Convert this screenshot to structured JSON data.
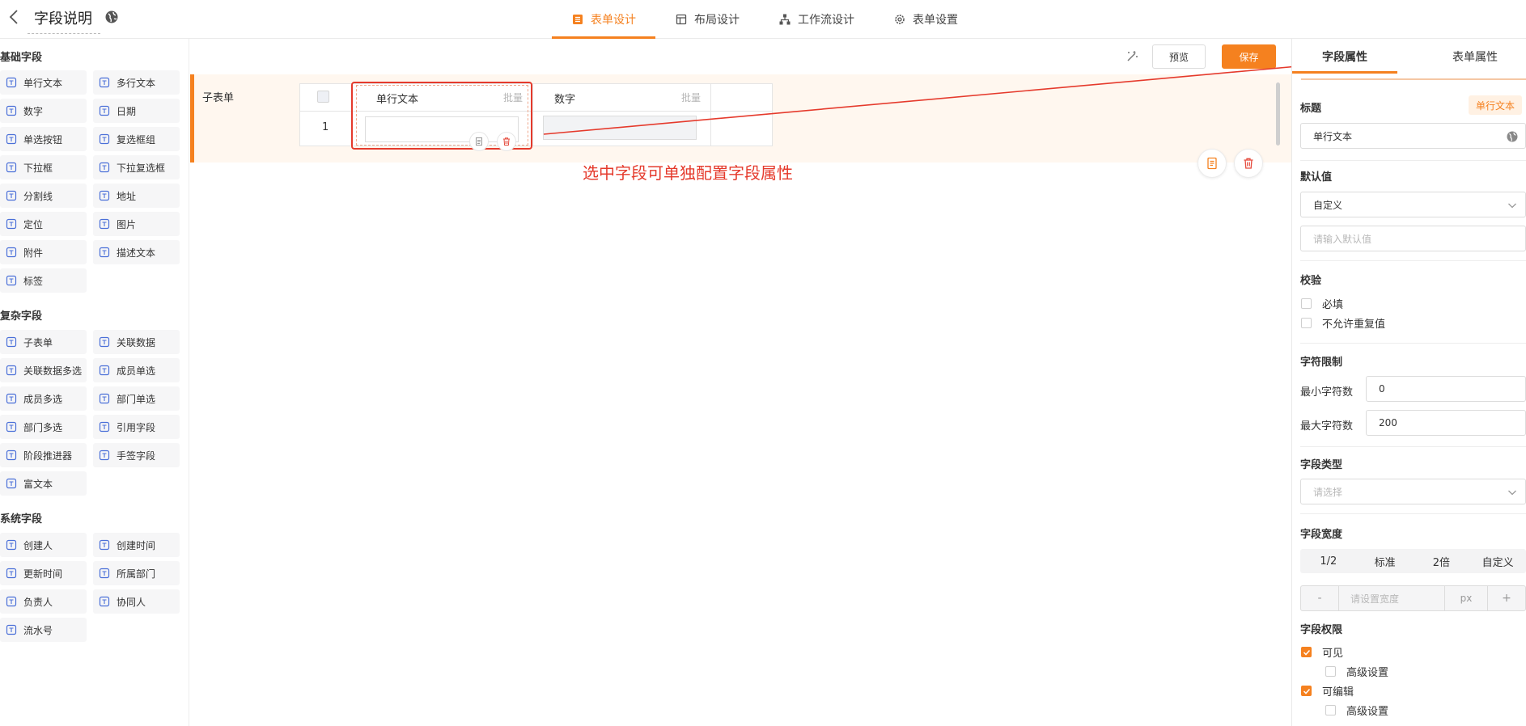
{
  "header": {
    "title": "字段说明",
    "tabs": [
      {
        "label": "表单设计",
        "icon": "form-list-icon"
      },
      {
        "label": "布局设计",
        "icon": "layout-icon"
      },
      {
        "label": "工作流设计",
        "icon": "workflow-icon"
      },
      {
        "label": "表单设置",
        "icon": "gear-icon"
      }
    ]
  },
  "palette": {
    "basic_title": "基础字段",
    "basic": [
      "单行文本",
      "多行文本",
      "数字",
      "日期",
      "单选按钮",
      "复选框组",
      "下拉框",
      "下拉复选框",
      "分割线",
      "地址",
      "定位",
      "图片",
      "附件",
      "描述文本",
      "标签"
    ],
    "complex_title": "复杂字段",
    "complex": [
      "子表单",
      "关联数据",
      "关联数据多选",
      "成员单选",
      "成员多选",
      "部门单选",
      "部门多选",
      "引用字段",
      "阶段推进器",
      "手签字段",
      "富文本"
    ],
    "system_title": "系统字段",
    "system": [
      "创建人",
      "创建时间",
      "更新时间",
      "所属部门",
      "负责人",
      "协同人",
      "流水号"
    ]
  },
  "canvas": {
    "preview_label": "预览",
    "save_label": "保存",
    "subform_label": "子表单",
    "row_number": "1",
    "columns": [
      {
        "title": "单行文本",
        "batch": "批量"
      },
      {
        "title": "数字",
        "batch": "批量"
      }
    ],
    "annotation": "选中字段可单独配置字段属性"
  },
  "panel": {
    "tabs": [
      "字段属性",
      "表单属性"
    ],
    "title_label": "标题",
    "title_tag": "单行文本",
    "title_value": "单行文本",
    "default_label": "默认值",
    "default_select": "自定义",
    "default_placeholder": "请输入默认值",
    "validate_label": "校验",
    "required_label": "必填",
    "unique_label": "不允许重复值",
    "char_limit_label": "字符限制",
    "min_label": "最小字符数",
    "min_value": "0",
    "max_label": "最大字符数",
    "max_value": "200",
    "type_label": "字段类型",
    "type_placeholder": "请选择",
    "width_label": "字段宽度",
    "width_options": [
      "1/2",
      "标准",
      "2倍",
      "自定义"
    ],
    "width_minus": "-",
    "width_placeholder": "请设置宽度",
    "width_unit": "px",
    "width_plus": "+",
    "perm_label": "字段权限",
    "visible_label": "可见",
    "advanced_label": "高级设置",
    "editable_label": "可编辑",
    "advanced_label2": "高级设置"
  },
  "colors": {
    "accent": "#f5811f",
    "annotation": "#e53a2c"
  }
}
